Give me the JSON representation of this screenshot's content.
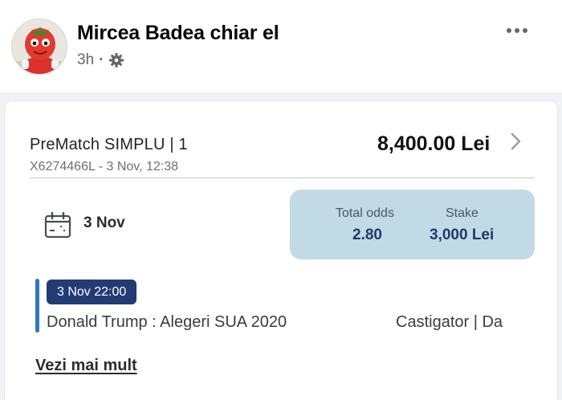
{
  "post": {
    "author": "Mircea Badea chiar el",
    "time": "3h",
    "separator": "·",
    "privacy_icon": "gear-icon",
    "more_icon": "more-dots-icon",
    "avatar_icon": "tomato-mascot-avatar"
  },
  "ticket": {
    "type": "PreMatch SIMPLU | 1",
    "id_line": "X6274466L - 3 Nov, 12:38",
    "payout": "8,400.00 Lei",
    "date": "3 Nov",
    "odds_label": "Total odds",
    "odds_value": "2.80",
    "stake_label": "Stake",
    "stake_value": "3,000 Lei",
    "event": {
      "time": "3 Nov 22:00",
      "name": "Donald Trump : Alegeri SUA 2020",
      "selection": "Castigator | Da"
    },
    "see_more": "Vezi mai mult"
  },
  "colors": {
    "odds_box": "#c2d9e6",
    "badge": "#223b73",
    "event_bar": "#2f78c0",
    "odds_text": "#1e3a6d"
  }
}
